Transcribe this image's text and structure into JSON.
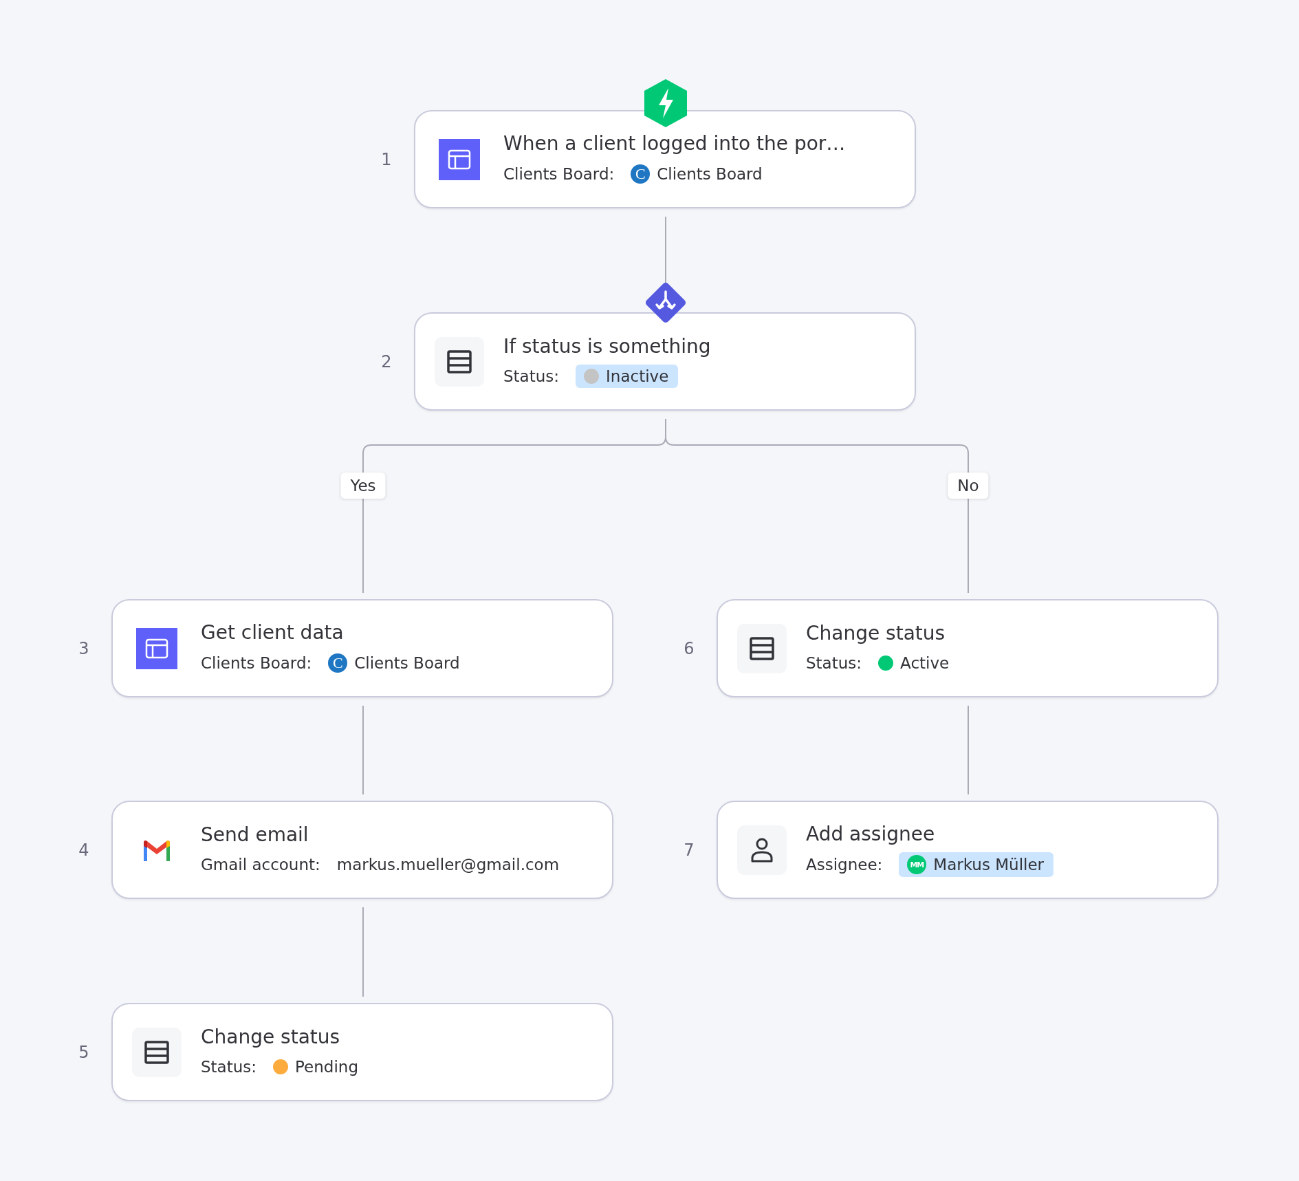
{
  "trigger": {
    "number": "1",
    "kind": "board",
    "title": "When a client logged into the por…",
    "field_label": "Clients Board:",
    "value": {
      "kind": "board",
      "badge": "C",
      "text": "Clients Board",
      "highlighted": false
    }
  },
  "condition": {
    "number": "2",
    "kind": "table",
    "title": "If status is something",
    "field_label": "Status:",
    "value": {
      "kind": "status",
      "color": "#c4c4c4",
      "text": "Inactive",
      "highlighted": true
    }
  },
  "branches": [
    {
      "label": "Yes",
      "steps": [
        {
          "number": "3",
          "kind": "board",
          "title": "Get client data",
          "field_label": "Clients Board:",
          "value": {
            "kind": "board",
            "badge": "C",
            "text": "Clients Board",
            "highlighted": false
          }
        },
        {
          "number": "4",
          "kind": "email",
          "title": "Send email",
          "field_label": "Gmail account:",
          "value": {
            "kind": "text",
            "text": "markus.mueller@gmail.com",
            "highlighted": false
          }
        },
        {
          "number": "5",
          "kind": "table",
          "title": "Change status",
          "field_label": "Status:",
          "value": {
            "kind": "status",
            "color": "#fdab3d",
            "text": "Pending",
            "highlighted": false
          }
        }
      ]
    },
    {
      "label": "No",
      "steps": [
        {
          "number": "6",
          "kind": "table",
          "title": "Change status",
          "field_label": "Status:",
          "value": {
            "kind": "status",
            "color": "#00c875",
            "text": "Active",
            "highlighted": false
          }
        },
        {
          "number": "7",
          "kind": "person",
          "title": "Add assignee",
          "field_label": "Assignee:",
          "value": {
            "kind": "person",
            "initials": "MM",
            "color": "#00c875",
            "text": "Markus Müller",
            "highlighted": true
          }
        }
      ]
    }
  ]
}
